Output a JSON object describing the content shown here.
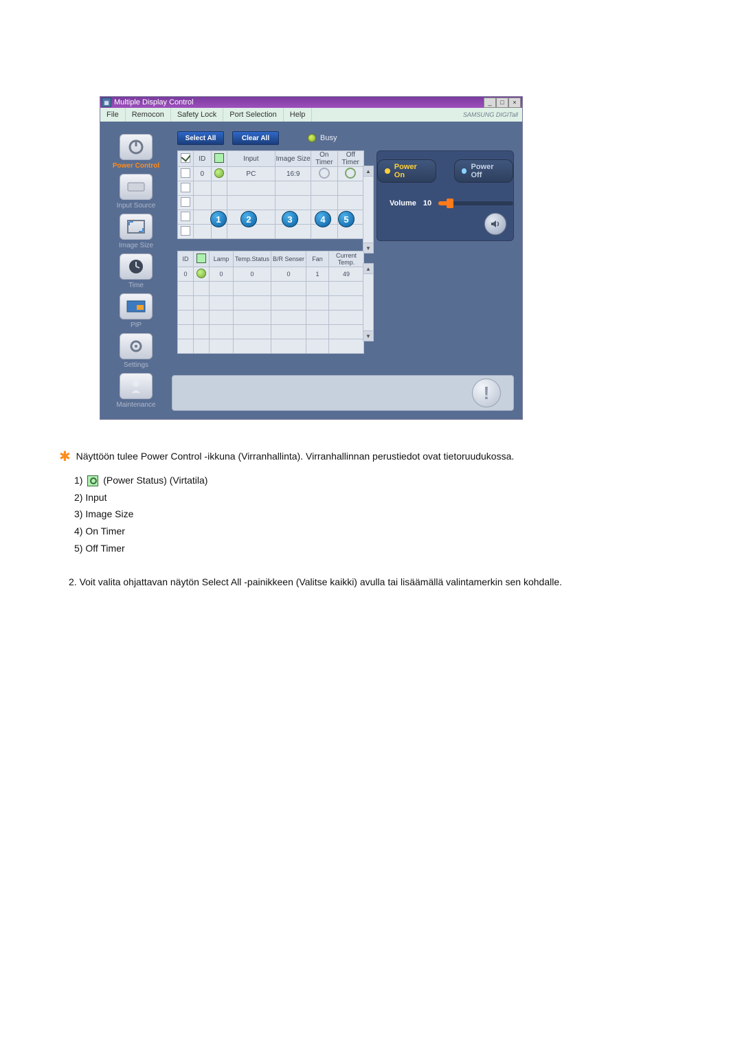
{
  "window": {
    "title": "Multiple Display Control"
  },
  "menu": {
    "file": "File",
    "remocon": "Remocon",
    "safety_lock": "Safety Lock",
    "port_selection": "Port Selection",
    "help": "Help"
  },
  "brand": "SAMSUNG DIGITall",
  "sidebar": {
    "power_control": "Power Control",
    "input_source": "Input Source",
    "image_size": "Image Size",
    "time": "Time",
    "pip": "PIP",
    "settings": "Settings",
    "maintenance": "Maintenance"
  },
  "buttons": {
    "select_all": "Select All",
    "clear_all": "Clear All"
  },
  "busy_label": "Busy",
  "upper_headers": {
    "id": "ID",
    "input": "Input",
    "image_size": "Image Size",
    "on_timer": "On Timer",
    "off_timer": "Off Timer"
  },
  "upper_row": {
    "id": "0",
    "input": "PC",
    "image_size": "16:9"
  },
  "lower_headers": {
    "id": "ID",
    "lamp": "Lamp",
    "temp_status": "Temp.Status",
    "br_sensor": "B/R Senser",
    "fan": "Fan",
    "current_temp": "Current Temp."
  },
  "lower_row": {
    "id": "0",
    "lamp": "0",
    "temp_status": "0",
    "br_sensor": "0",
    "fan": "1",
    "current_temp": "49"
  },
  "right_panel": {
    "power_on": "Power On",
    "power_off": "Power Off",
    "volume_label": "Volume",
    "volume_value": "10"
  },
  "callout_values": [
    "1",
    "2",
    "3",
    "4",
    "5"
  ],
  "desc": {
    "intro": "Näyttöön tulee Power Control -ikkuna (Virranhallinta). Virranhallinnan perustiedot ovat tietoruudukossa.",
    "li1_prefix": "1)",
    "li1_suffix": "(Power Status) (Virtatila)",
    "li2": "2) Input",
    "li3": "3) Image Size",
    "li4": "4) On Timer",
    "li5": "5) Off Timer",
    "p2": "2.   Voit valita ohjattavan näytön Select All -painikkeen (Valitse kaikki) avulla tai lisäämällä valintamerkin sen kohdalle."
  }
}
